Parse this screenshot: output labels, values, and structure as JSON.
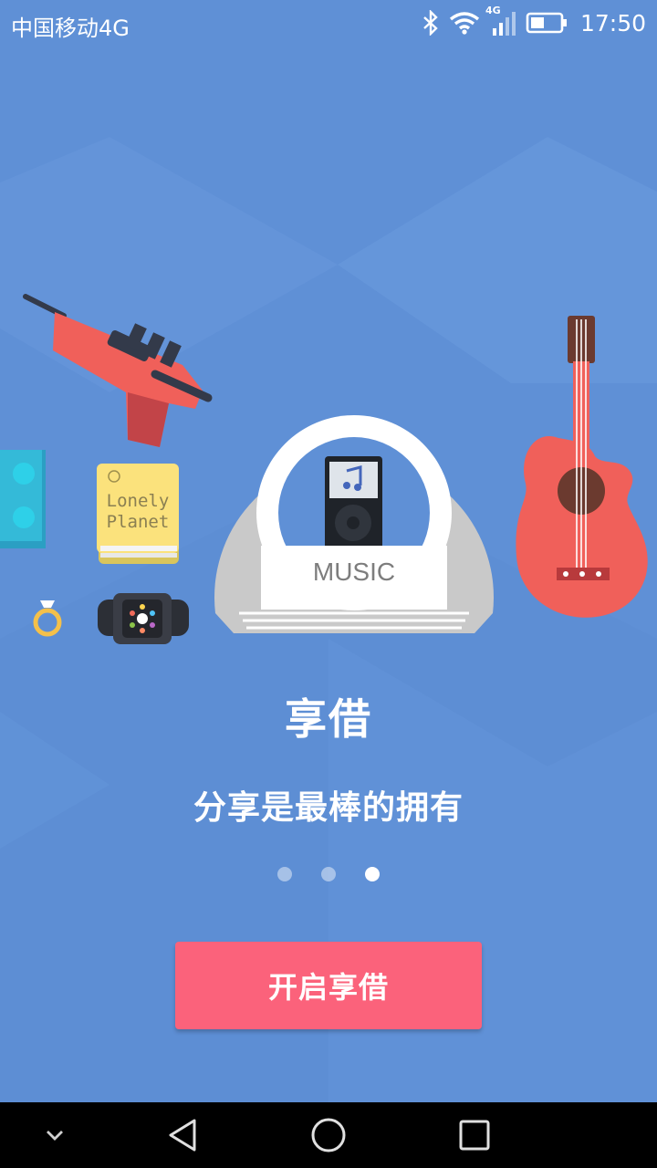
{
  "status_bar": {
    "carrier": "中国移动4G",
    "network_badge": "4G",
    "time": "17:50",
    "icons": [
      "bluetooth-icon",
      "wifi-icon",
      "cellular-signal-icon",
      "battery-icon"
    ]
  },
  "illustration": {
    "book_line1": "Lonely",
    "book_line2": "Planet",
    "speaker_label": "MUSIC"
  },
  "onboarding": {
    "title": "享借",
    "subtitle": "分享是最棒的拥有",
    "page_count": 3,
    "current_page": 3
  },
  "actions": {
    "start_label": "开启享借"
  },
  "nav_bar": {
    "icons": [
      "chevron-down-icon",
      "back-icon",
      "home-icon",
      "recents-icon"
    ]
  },
  "colors": {
    "background": "#5f90d6",
    "button": "#fb627b",
    "accent_red": "#f0605a"
  }
}
